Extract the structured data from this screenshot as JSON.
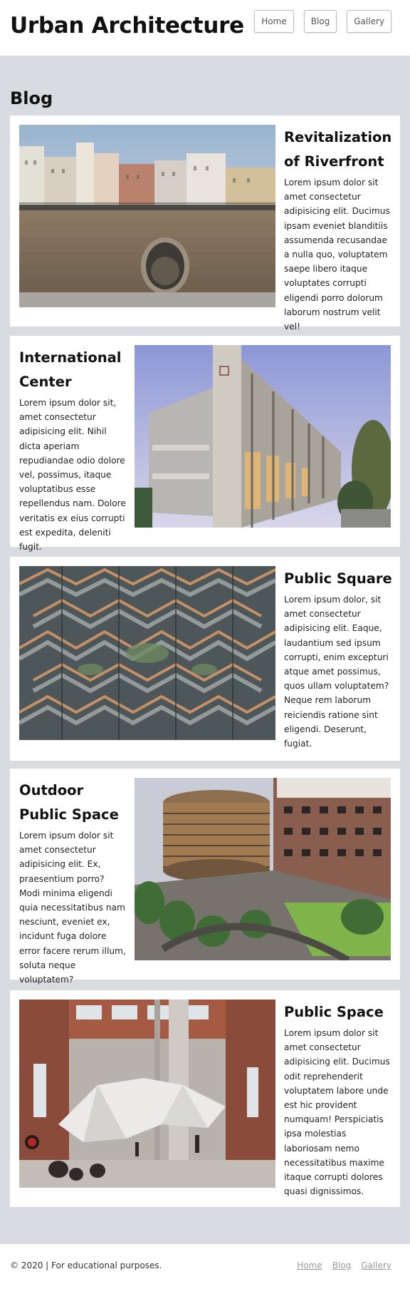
{
  "header": {
    "site_title": "Urban Architecture",
    "nav": [
      "Home",
      "Blog",
      "Gallery"
    ]
  },
  "main": {
    "section_title": "Blog",
    "posts": [
      {
        "title": "Revitalization of Riverfront",
        "body": "Lorem ipsum dolor sit amet consectetur adipisicing elit. Ducimus ipsam eveniet blanditiis assumenda recusandae a nulla quo, voluptatem saepe libero itaque voluptates corrupti eligendi porro dolorum laborum nostrum velit vel!"
      },
      {
        "title": "International Center",
        "body": "Lorem ipsum dolor sit, amet consectetur adipisicing elit. Nihil dicta aperiam repudiandae odio dolore vel, possimus, itaque voluptatibus esse repellendus nam. Dolore veritatis ex eius corrupti est expedita, deleniti fugit."
      },
      {
        "title": "Public Square",
        "body": "Lorem ipsum dolor, sit amet consectetur adipisicing elit. Eaque, laudantium sed ipsum corrupti, enim excepturi atque amet possimus, quos ullam voluptatem? Neque rem laborum reiciendis ratione sint eligendi. Deserunt, fugiat."
      },
      {
        "title": "Outdoor Public Space",
        "body": "Lorem ipsum dolor sit amet consectetur adipisicing elit. Ex, praesentium porro? Modi minima eligendi quia necessitatibus nam nesciunt, eveniet ex, incidunt fuga dolore error facere rerum illum, soluta neque voluptatem?"
      },
      {
        "title": "Public Space",
        "body": "Lorem ipsum dolor sit amet consectetur adipisicing elit. Ducimus odit reprehenderit voluptatem labore unde est hic provident numquam! Perspiciatis ipsa molestias laboriosam nemo necessitatibus maxime itaque corrupti dolores quasi dignissimos."
      }
    ]
  },
  "footer": {
    "copyright": "© 2020 | For educational purposes.",
    "links": [
      "Home",
      "Blog",
      "Gallery"
    ]
  }
}
